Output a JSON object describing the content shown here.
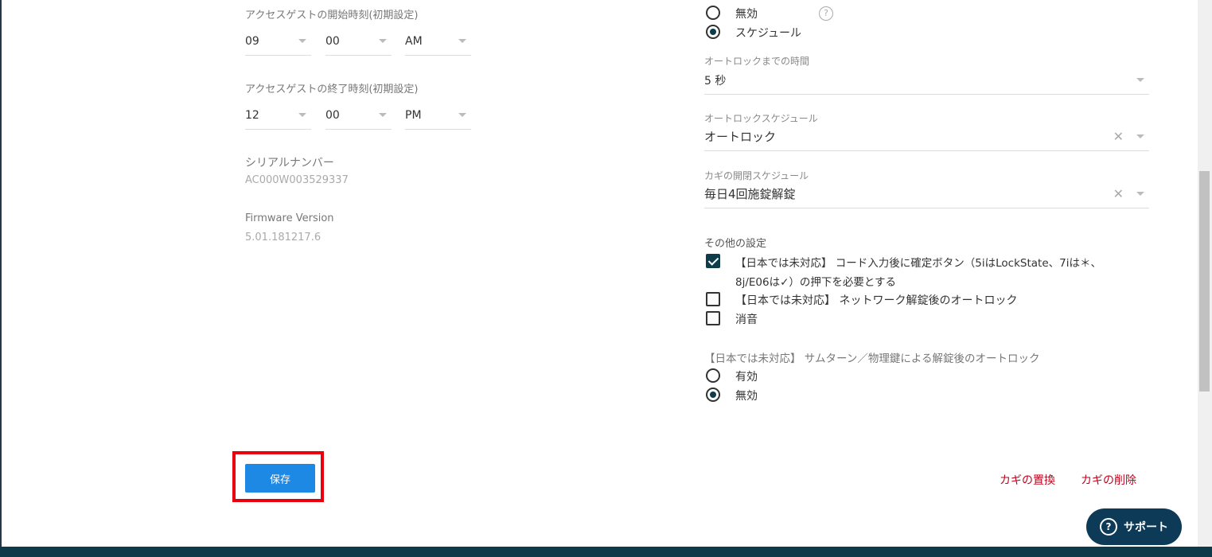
{
  "left": {
    "start_time_label": "アクセスゲストの開始時刻(初期設定)",
    "start_hour": "09",
    "start_minute": "00",
    "start_ampm": "AM",
    "end_time_label": "アクセスゲストの終了時刻(初期設定)",
    "end_hour": "12",
    "end_minute": "00",
    "end_ampm": "PM",
    "serial_label": "シリアルナンバー",
    "serial_value": "AC000W003529337",
    "firmware_label": "Firmware Version",
    "firmware_value": "5.01.181217.6"
  },
  "right": {
    "autolock_mode_options": [
      {
        "label": "無効",
        "selected": false
      },
      {
        "label": "スケジュール",
        "selected": true
      }
    ],
    "autolock_time_label": "オートロックまでの時間",
    "autolock_time_value": "5 秒",
    "autolock_schedule_label": "オートロックスケジュール",
    "autolock_schedule_value": "オートロック",
    "key_schedule_label": "カギの開閉スケジュール",
    "key_schedule_value": "毎日4回施錠解錠",
    "other_settings_label": "その他の設定",
    "other_settings": [
      {
        "line1": "【日本では未対応】 コード入力後に確定ボタン（5iはLockState、7iは＊、",
        "line2": "8j/E06は✓）の押下を必要とする",
        "checked": true
      },
      {
        "line1": "【日本では未対応】 ネットワーク解錠後のオートロック",
        "checked": false
      },
      {
        "line1": "消音",
        "checked": false
      }
    ],
    "thumbturn_label": "【日本では未対応】 サムターン／物理鍵による解錠後のオートロック",
    "thumbturn_options": [
      {
        "label": "有効",
        "selected": false
      },
      {
        "label": "無効",
        "selected": true
      }
    ]
  },
  "actions": {
    "save_label": "保存",
    "replace_key_label": "カギの置換",
    "delete_key_label": "カギの削除",
    "support_label": "サポート"
  },
  "icons": {
    "help": "question-circle-icon",
    "clear": "clear-x-icon",
    "dropdown": "caret-down-icon"
  },
  "colors": {
    "primary_button": "#1e88e5",
    "highlight": "#e8000d",
    "danger_link": "#c0001a",
    "radio_check": "#0e3c4a",
    "support": "#0c3a57"
  }
}
